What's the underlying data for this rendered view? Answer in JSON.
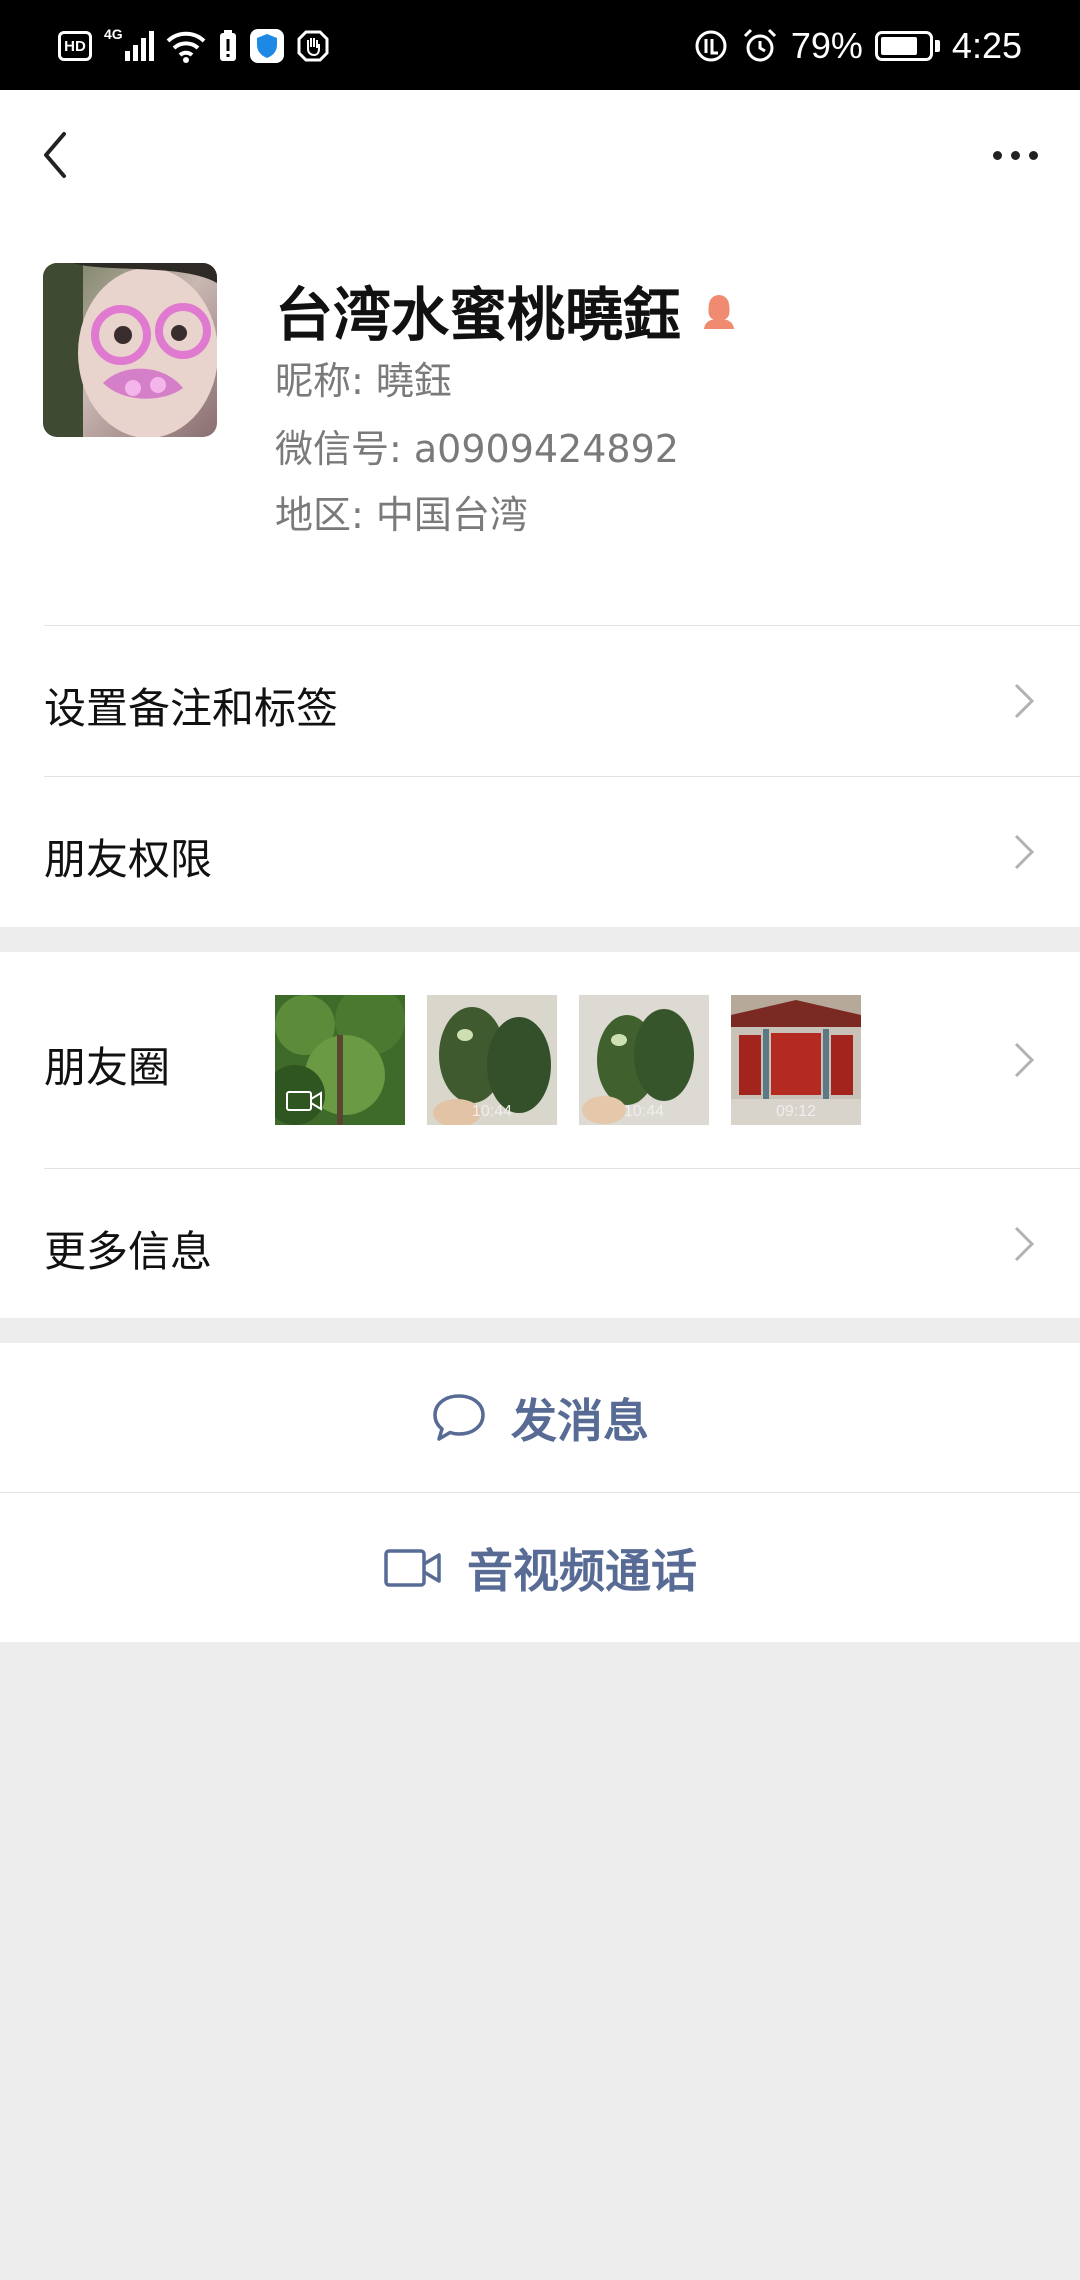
{
  "status_bar": {
    "network": "4G",
    "battery": "79%",
    "battery_level": 0.79,
    "time": "4:25"
  },
  "profile": {
    "name": "台湾水蜜桃曉鈺",
    "nickname": "昵称:  曉鈺",
    "wechat_id": "微信号:  a0909424892",
    "region": "地区:  中国台湾"
  },
  "menu": {
    "remark_tags": "设置备注和标签",
    "friend_permissions": "朋友权限",
    "moments": "朋友圈",
    "more_info": "更多信息"
  },
  "moments_thumbs": [
    {
      "type": "video",
      "time": ""
    },
    {
      "type": "photo",
      "time": "10:44"
    },
    {
      "type": "photo",
      "time": "10:44"
    },
    {
      "type": "photo",
      "time": "09:12"
    }
  ],
  "actions": {
    "send_message": "发消息",
    "video_call": "音视频通话"
  },
  "colors": {
    "link": "#576b95",
    "background": "#ededed",
    "gender_icon": "#f08b72"
  }
}
